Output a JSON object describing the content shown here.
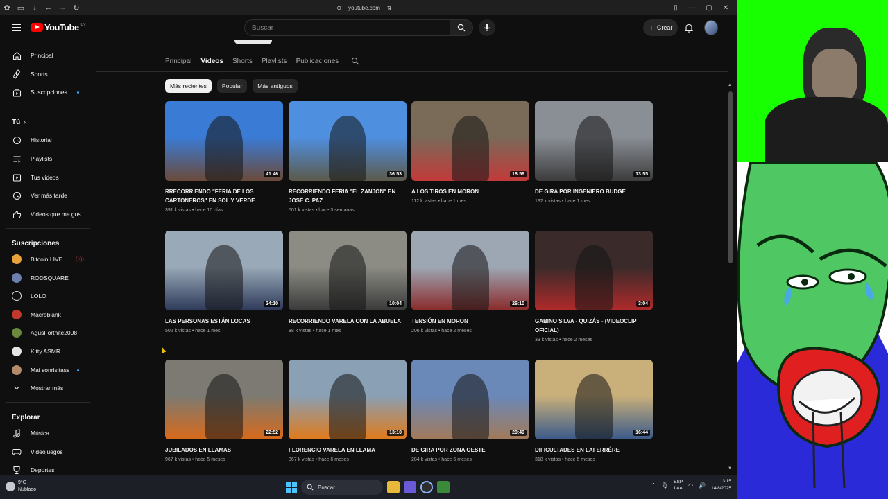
{
  "browser": {
    "url": "youtube.com"
  },
  "header": {
    "logo_text": "YouTube",
    "country_code": "UY",
    "search_placeholder": "Buscar",
    "create_label": "Crear"
  },
  "sidebar": {
    "main": [
      {
        "label": "Principal",
        "icon": "home-icon"
      },
      {
        "label": "Shorts",
        "icon": "shorts-icon"
      },
      {
        "label": "Suscripciones",
        "icon": "subscriptions-icon"
      }
    ],
    "you_heading": "Tú",
    "you": [
      {
        "label": "Historial",
        "icon": "history-icon"
      },
      {
        "label": "Playlists",
        "icon": "playlists-icon"
      },
      {
        "label": "Tus videos",
        "icon": "your-videos-icon"
      },
      {
        "label": "Ver más tarde",
        "icon": "watch-later-icon"
      },
      {
        "label": "Videos que me gus...",
        "icon": "like-icon"
      }
    ],
    "subs_heading": "Suscripciones",
    "subs": [
      {
        "label": "Bitcoin LIVE",
        "color": "#e8a23a"
      },
      {
        "label": "RODSQUARE",
        "color": "#6d7fae"
      },
      {
        "label": "LOLO",
        "color": "#111111"
      },
      {
        "label": "Macroblank",
        "color": "#c0392b"
      },
      {
        "label": "AgusFortnite2008",
        "color": "#6a8a3c"
      },
      {
        "label": "Kitty ASMR",
        "color": "#e5e5e5"
      },
      {
        "label": "Mai sonrisitass",
        "color": "#b38a6a"
      }
    ],
    "show_more": "Mostrar más",
    "explore_heading": "Explorar",
    "explore": [
      {
        "label": "Música",
        "icon": "music-icon"
      },
      {
        "label": "Videojuegos",
        "icon": "gaming-icon"
      },
      {
        "label": "Deportes",
        "icon": "sports-icon"
      }
    ]
  },
  "tabs": [
    "Principal",
    "Videos",
    "Shorts",
    "Playlists",
    "Publicaciones"
  ],
  "active_tab": "Videos",
  "chips": [
    "Más recientes",
    "Popular",
    "Más antiguos"
  ],
  "videos": [
    {
      "title": "RRECORRIENDO \"FERIA DE LOS CARTONEROS\" EN SOL Y VERDE",
      "meta": "391 k vistas • hace 10 días",
      "duration": "41:46",
      "c1": "#3a7bd5",
      "c2": "#6b4a3a"
    },
    {
      "title": "RECORRIENDO FERIA \"EL ZANJON\" EN JOSÉ C. PAZ",
      "meta": "501 k vistas • hace 3 semanas",
      "duration": "36:53",
      "c1": "#4f8fe0",
      "c2": "#5c5a4a"
    },
    {
      "title": "A LOS TIROS EN MORON",
      "meta": "112 k vistas • hace 1 mes",
      "duration": "18:59",
      "c1": "#7a6a58",
      "c2": "#c23a3a"
    },
    {
      "title": "DE GIRA POR INGENIERO BUDGE",
      "meta": "192 k vistas • hace 1 mes",
      "duration": "13:55",
      "c1": "#8a8f96",
      "c2": "#3c3c3c"
    },
    {
      "title": "LAS PERSONAS ESTÁN LOCAS",
      "meta": "502 k vistas • hace 1 mes",
      "duration": "24:10",
      "c1": "#9aa9b8",
      "c2": "#2e3a5a"
    },
    {
      "title": "RECORRIENDO VARELA CON LA ABUELA",
      "meta": "88 k vistas • hace 1 mes",
      "duration": "10:04",
      "c1": "#8c8c84",
      "c2": "#3a3a3a"
    },
    {
      "title": "TENSIÓN EN MORON",
      "meta": "206 k vistas • hace 2 meses",
      "duration": "26:10",
      "c1": "#9da7b4",
      "c2": "#8a2a2a"
    },
    {
      "title": "GABINO SILVA - QUIZÁS - (VIDEOCLIP OFICIAL)",
      "meta": "33 k vistas • hace 2 meses",
      "duration": "3:04",
      "c1": "#3a2a2a",
      "c2": "#b02a2a"
    },
    {
      "title": "JUBILADOS EN LLAMAS",
      "meta": "967 k vistas • hace 5 meses",
      "duration": "22:52",
      "c1": "#7c7a72",
      "c2": "#d86a1a"
    },
    {
      "title": "FLORENCIO VARELA EN LLAMA",
      "meta": "367 k vistas • hace 6 meses",
      "duration": "13:10",
      "c1": "#8aa0b4",
      "c2": "#e07a1a"
    },
    {
      "title": "DE GIRA POR ZONA OESTE",
      "meta": "284 k vistas • hace 6 meses",
      "duration": "20:49",
      "c1": "#6a88b8",
      "c2": "#a27a5a"
    },
    {
      "title": "DIFICULTADES EN LAFERRÉRE",
      "meta": "318 k vistas • hace 6 meses",
      "duration": "16:44",
      "c1": "#c9b07a",
      "c2": "#3a5a8a"
    }
  ],
  "taskbar": {
    "temperature": "9°C",
    "weather": "Nublado",
    "search_label": "Buscar",
    "lang_line1": "ESP",
    "lang_line2": "LAA",
    "time": "13:15",
    "date": "14/8/2025"
  }
}
